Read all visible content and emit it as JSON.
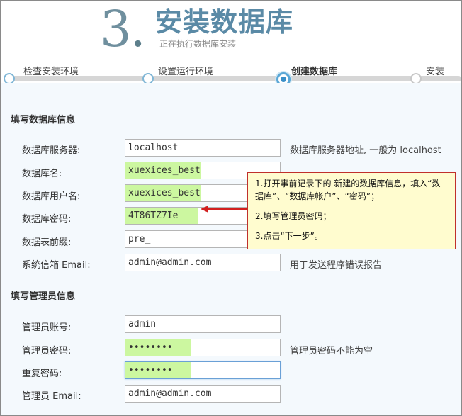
{
  "header": {
    "step_number": "3",
    "step_dot": ".",
    "title": "安装数据库",
    "subtitle": "正在执行数据库安装"
  },
  "steps": [
    {
      "label": "检查安装环境",
      "state": "done"
    },
    {
      "label": "设置运行环境",
      "state": "done"
    },
    {
      "label": "创建数据库",
      "state": "active"
    },
    {
      "label": "安装",
      "state": "pending"
    }
  ],
  "db_section": {
    "title": "填写数据库信息",
    "server_label": "数据库服务器:",
    "server_value": "localhost",
    "server_hint": "数据库服务器地址, 一般为 localhost",
    "name_label": "数据库名:",
    "name_value": "xuexices_best",
    "user_label": "数据库用户名:",
    "user_value": "xuexices_best",
    "password_label": "数据库密码:",
    "password_value": "4T86TZ7Ie",
    "prefix_label": "数据表前缀:",
    "prefix_value": "pre_",
    "email_label": "系统信箱 Email:",
    "email_value": "admin@admin.com",
    "email_hint": "用于发送程序错误报告"
  },
  "admin_section": {
    "title": "填写管理员信息",
    "account_label": "管理员账号:",
    "account_value": "admin",
    "password_label": "管理员密码:",
    "password_value": "••••••••",
    "password_hint": "管理员密码不能为空",
    "repeat_label": "重复密码:",
    "repeat_value": "••••••••",
    "email_label": "管理员 Email:",
    "email_value": "admin@admin.com"
  },
  "callout": {
    "line1": "1.打开事前记录下的 新建的数据库信息，填入“数据库”、“数据库帐户”、“密码”；",
    "line2": "2.填写管理员密码；",
    "line3": "3.点击“下一步”。"
  },
  "colors": {
    "highlight": "#ccf7a0",
    "callout_bg": "#fffccf",
    "callout_border": "#c0302c",
    "arrow": "#d21f1f",
    "title": "#5a8aa6"
  }
}
